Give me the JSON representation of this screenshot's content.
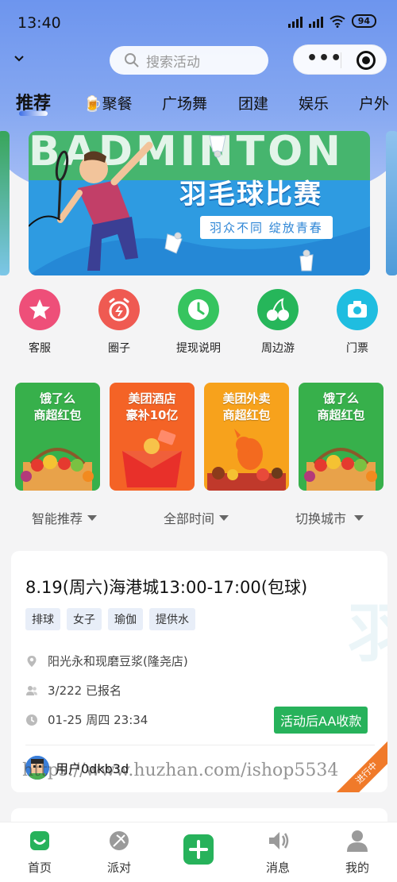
{
  "status_bar": {
    "time": "13:40",
    "battery": "94"
  },
  "header": {
    "search_placeholder": "搜索活动"
  },
  "tabs": [
    "推荐",
    "🍺聚餐",
    "广场舞",
    "团建",
    "娱乐",
    "户外"
  ],
  "banner": {
    "bg_text": "BADMINTON",
    "title": "羽毛球比赛",
    "subtitle": "羽众不同 绽放青春"
  },
  "quick_icons": [
    {
      "label": "客服",
      "icon": "star-icon",
      "color": "#ee4f79"
    },
    {
      "label": "圈子",
      "icon": "alarm-clock-icon",
      "color": "#ef5a52"
    },
    {
      "label": "提现说明",
      "icon": "clock-icon",
      "color": "#36c45f"
    },
    {
      "label": "周边游",
      "icon": "cherry-icon",
      "color": "#26b65a"
    },
    {
      "label": "门票",
      "icon": "camera-icon",
      "color": "#1fbde0"
    }
  ],
  "promos": [
    {
      "line1": "饿了么",
      "line2": "商超红包",
      "bg": "#37b04b"
    },
    {
      "line1": "美团酒店",
      "line2": "豪补10亿",
      "bg": "#f46326"
    },
    {
      "line1": "美团外卖",
      "line2": "商超红包",
      "bg": "#f7a21c"
    },
    {
      "line1": "饿了么",
      "line2": "商超红包",
      "bg": "#37b04b"
    }
  ],
  "filters": [
    "智能推荐",
    "全部时间",
    "切换城市"
  ],
  "activity": {
    "title": "8.19(周六)海港城13:00-17:00(包球)",
    "tags": [
      "排球",
      "女子",
      "瑜伽",
      "提供水"
    ],
    "location": "阳光永和现磨豆浆(隆尧店)",
    "signup": "3/222 已报名",
    "time": "01-25 周四 23:34",
    "payment": "活动后AA收款",
    "user": "用户0dkb3d",
    "status": "进行中"
  },
  "watermark": "https://www.huzhan.com/ishop5534",
  "tabbar": [
    {
      "label": "首页",
      "icon": "home-icon",
      "active": true
    },
    {
      "label": "派对",
      "icon": "party-icon",
      "active": false
    },
    {
      "label": "",
      "icon": "plus-icon",
      "active": false
    },
    {
      "label": "消息",
      "icon": "speaker-icon",
      "active": false
    },
    {
      "label": "我的",
      "icon": "user-icon",
      "active": false
    }
  ],
  "colors": {
    "header": "#6d95ee",
    "accent_green": "#27b25b",
    "tag_bg": "#e8eef8"
  }
}
